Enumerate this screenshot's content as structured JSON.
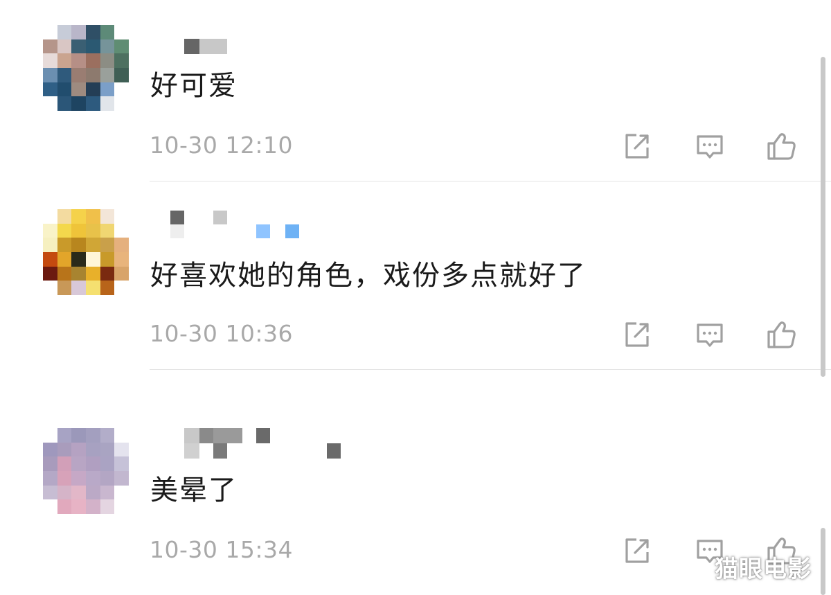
{
  "comments": [
    {
      "text": "好可爱",
      "time": "10-30 12:10",
      "avatar_colors": [
        "#ffffff",
        "#c7ccd8",
        "#b9b6c9",
        "#2f4f66",
        "#5d8a78",
        "#ffffff",
        "#b5958a",
        "#d9c6c4",
        "#3a5f73",
        "#2b5972",
        "#76949a",
        "#5f8d73",
        "#e7dbd9",
        "#caa48f",
        "#b68f86",
        "#9b6f5f",
        "#8c8d84",
        "#4d7060",
        "#6b8fb1",
        "#2f5a7c",
        "#9a7d72",
        "#8d7a6e",
        "#9aa09b",
        "#3f5f55",
        "#2f5f86",
        "#214d6e",
        "#9e8b80",
        "#243e56",
        "#7b9fc8",
        "#ffffff",
        "#ffffff",
        "#2b5678",
        "#1e4461",
        "#2d5a7e",
        "#e1e5ea",
        "#ffffff"
      ]
    },
    {
      "text": "好喜欢她的角色，戏份多点就好了",
      "time": "10-30 10:36",
      "avatar_colors": [
        "#ffffff",
        "#f3dba0",
        "#f5d24a",
        "#f0c04a",
        "#f3e6d8",
        "#ffffff",
        "#f9f3c8",
        "#f3d84c",
        "#efc43a",
        "#e8c24a",
        "#f0d672",
        "#ffffff",
        "#f6f0c0",
        "#c99a2a",
        "#b8861e",
        "#d0a636",
        "#c9a04a",
        "#e5b07e",
        "#c44a10",
        "#e2a52a",
        "#2a2a1a",
        "#fff6d8",
        "#c89a2a",
        "#e8b47c",
        "#6b1a10",
        "#b8741a",
        "#a88430",
        "#e8b02a",
        "#7a2a10",
        "#d8a46a",
        "#ffffff",
        "#c89858",
        "#d8c8d8",
        "#f5e070",
        "#b8641a",
        "#ffffff"
      ]
    },
    {
      "text": "美晕了",
      "time": "10-30 15:34",
      "avatar_colors": [
        "#ffffff",
        "#a7a3c4",
        "#9b98ba",
        "#a39fbf",
        "#b2adc9",
        "#ffffff",
        "#9f98bd",
        "#a99cbc",
        "#b5a2c2",
        "#a7a1c1",
        "#a9a4c2",
        "#e4e3ee",
        "#a89bbc",
        "#d29fb8",
        "#b8a5c4",
        "#b09fc1",
        "#aaa3c3",
        "#c6c2d8",
        "#b4a8c6",
        "#d7a2b9",
        "#c6a8c6",
        "#b9a9c8",
        "#b3a6c4",
        "#c2b7cf",
        "#c7bdd3",
        "#d5b4c8",
        "#e2b7c8",
        "#bba9c6",
        "#c9b7cf",
        "#ffffff",
        "#ffffff",
        "#e1a9bd",
        "#e7b3c5",
        "#d3b2c9",
        "#e4d5e1",
        "#ffffff"
      ]
    }
  ],
  "icons": {
    "share": "share-icon",
    "reply": "comment-icon",
    "like": "thumbs-up-icon"
  },
  "colors": {
    "text": "#1a1a1a",
    "time": "#a9a9a9",
    "icon": "#a0a0a0",
    "divider": "#e3e3e3"
  },
  "watermark": "猫眼电影"
}
